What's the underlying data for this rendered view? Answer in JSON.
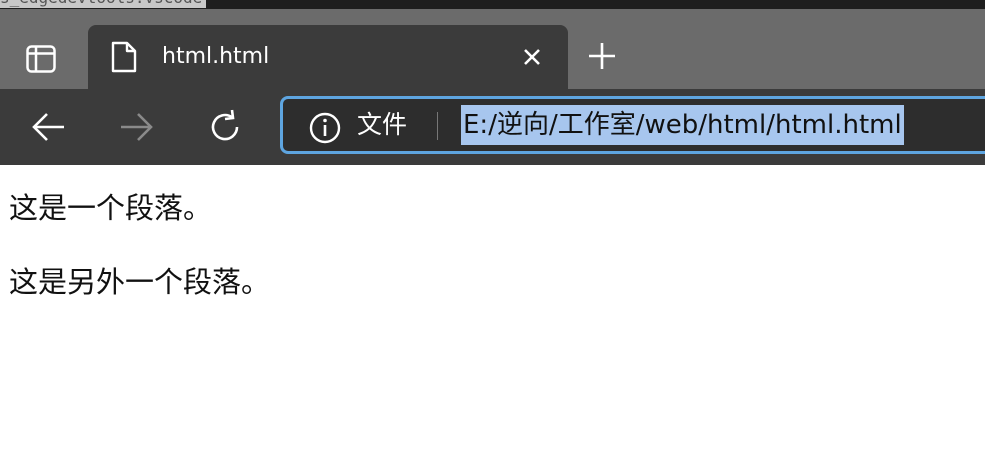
{
  "editor_strip": {
    "cut_text": "s_edgedevtools.vscode"
  },
  "tabbar": {
    "tab_actions_icon": "tab-actions-icon",
    "active_tab": {
      "title": "html.html",
      "icon": "file-icon",
      "close_icon": "close-icon"
    },
    "new_tab_icon": "plus-icon"
  },
  "toolbar": {
    "back_icon": "arrow-left-icon",
    "forward_icon": "arrow-right-icon",
    "refresh_icon": "refresh-icon",
    "address": {
      "info_icon": "info-icon",
      "site_label": "文件",
      "url": "E:/逆向/工作室/web/html/html.html",
      "url_selected": true
    }
  },
  "page": {
    "paragraphs": [
      "这是一个段落。",
      "这是另外一个段落。"
    ]
  },
  "colors": {
    "tabbar_bg": "#6b6b6b",
    "active_tab_bg": "#3b3b3b",
    "address_focus_border": "#5ea5e0",
    "url_selection": "#a7c6ee"
  }
}
